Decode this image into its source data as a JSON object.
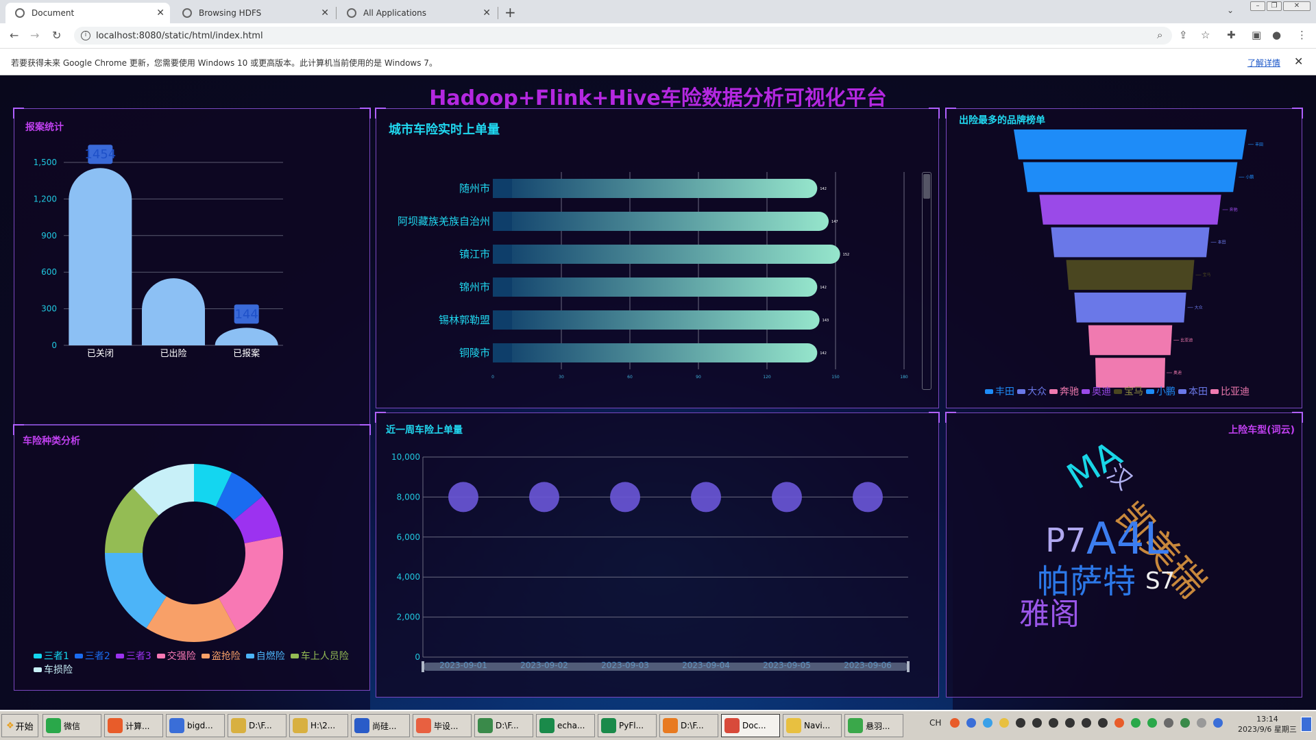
{
  "browser": {
    "tabs": [
      {
        "label": "Document",
        "active": true
      },
      {
        "label": "Browsing HDFS",
        "active": false
      },
      {
        "label": "All Applications",
        "active": false
      }
    ],
    "url": "localhost:8080/static/html/index.html",
    "infobar_message": "若要获得未来 Google Chrome 更新，您需要使用 Windows 10 或更高版本。此计算机当前使用的是 Windows 7。",
    "infobar_link": "了解详情"
  },
  "page": {
    "title": "Hadoop+Flink+Hive车险数据分析可视化平台",
    "panels": {
      "report": "报案统计",
      "city": "城市车险实时上单量",
      "brand": "出险最多的品牌榜单",
      "category": "车险种类分析",
      "week": "近一周车险上单量",
      "cloud": "上险车型(词云)"
    }
  },
  "colors": {
    "accent": "#b428e0",
    "title_cyan": "#20d8f0",
    "title_purple": "#c040f0",
    "bar_blue": "#8cc0f4"
  },
  "chart_data": [
    {
      "id": "report",
      "type": "bar",
      "categories": [
        "已关闭",
        "已出险",
        "已报案"
      ],
      "values": [
        1454,
        550,
        144
      ],
      "data_labels": [
        "1454",
        "",
        "144"
      ],
      "ylim": [
        0,
        1500
      ],
      "yticks": [
        0,
        300,
        600,
        900,
        1200,
        1500
      ],
      "yticks_labels": [
        "0",
        "300",
        "600",
        "900",
        "1,200",
        "1,500"
      ],
      "grid": true
    },
    {
      "id": "city",
      "type": "bar",
      "orientation": "horizontal",
      "categories": [
        "随州市",
        "阿坝藏族羌族自治州",
        "镇江市",
        "锦州市",
        "锡林郭勒盟",
        "铜陵市"
      ],
      "values": [
        142,
        147,
        152,
        142,
        143,
        142
      ],
      "xlim": [
        0,
        180
      ],
      "xticks": [
        0,
        30,
        60,
        90,
        120,
        150,
        180
      ],
      "grid": true
    },
    {
      "id": "brand",
      "type": "funnel",
      "categories": [
        "丰田",
        "小鹏",
        "奔驰",
        "本田",
        "宝马",
        "大众",
        "比亚迪",
        "奥迪"
      ],
      "values": [
        100,
        92,
        78,
        68,
        55,
        48,
        36,
        30
      ],
      "colors": [
        "#1e8cf8",
        "#1e8cf8",
        "#9a4ae8",
        "#6a78e8",
        "#4a4620",
        "#6a78e8",
        "#f07ab0",
        "#f07ab0"
      ],
      "legend": [
        {
          "name": "丰田",
          "color": "#1e8cf8"
        },
        {
          "name": "大众",
          "color": "#6a78e8"
        },
        {
          "name": "奔驰",
          "color": "#f07ab0"
        },
        {
          "name": "奥迪",
          "color": "#9a4ae8"
        },
        {
          "name": "宝马",
          "color": "#4a4620"
        },
        {
          "name": "小鹏",
          "color": "#1e8cf8"
        },
        {
          "name": "本田",
          "color": "#6a78e8"
        },
        {
          "name": "比亚迪",
          "color": "#f07ab0"
        }
      ]
    },
    {
      "id": "category",
      "type": "pie",
      "donut": true,
      "slices": [
        {
          "name": "三者1",
          "value": 7,
          "color": "#14d6f0"
        },
        {
          "name": "三者2",
          "value": 7,
          "color": "#1a6cf0"
        },
        {
          "name": "三者3",
          "value": 8,
          "color": "#9c32f0"
        },
        {
          "name": "交强险",
          "value": 20,
          "color": "#f878b4"
        },
        {
          "name": "盗抢险",
          "value": 17,
          "color": "#f8a068"
        },
        {
          "name": "自燃险",
          "value": 16,
          "color": "#4cb4f8"
        },
        {
          "name": "车上人员险",
          "value": 13,
          "color": "#94bc54"
        },
        {
          "name": "车损险",
          "value": 12,
          "color": "#c8f0f8"
        }
      ]
    },
    {
      "id": "week",
      "type": "scatter",
      "x": [
        "2023-09-01",
        "2023-09-02",
        "2023-09-03",
        "2023-09-04",
        "2023-09-05",
        "2023-09-06"
      ],
      "y": [
        8000,
        8000,
        8000,
        8000,
        8000,
        8000
      ],
      "ylim": [
        0,
        10000
      ],
      "yticks": [
        0,
        2000,
        4000,
        6000,
        8000,
        10000
      ],
      "yticks_labels": [
        "0",
        "2,000",
        "4,000",
        "6,000",
        "8,000",
        "10,000"
      ],
      "grid": true
    }
  ],
  "wordcloud": [
    {
      "text": "MA",
      "color": "#19d6e6"
    },
    {
      "text": "汉",
      "color": "#b0b0f0"
    },
    {
      "text": "凯美瑞",
      "color": "#c8883c"
    },
    {
      "text": "P7",
      "color": "#b0a8f0"
    },
    {
      "text": "A4L",
      "color": "#3c7ef0"
    },
    {
      "text": "帕萨特",
      "color": "#2c78e8"
    },
    {
      "text": "S7",
      "color": "#f0f0f0"
    },
    {
      "text": "雅阁",
      "color": "#9a56e8"
    }
  ],
  "taskbar": {
    "start": "开始",
    "items": [
      "微信",
      "计算...",
      "bigd...",
      "D:\\F...",
      "H:\\2...",
      "尚硅...",
      "毕设...",
      "D:\\F...",
      "echa...",
      "PyFl...",
      "D:\\F...",
      "Doc...",
      "Navi...",
      "悬羽..."
    ],
    "tray_lang": "CH",
    "time": "13:14",
    "date": "2023/9/6 星期三"
  }
}
